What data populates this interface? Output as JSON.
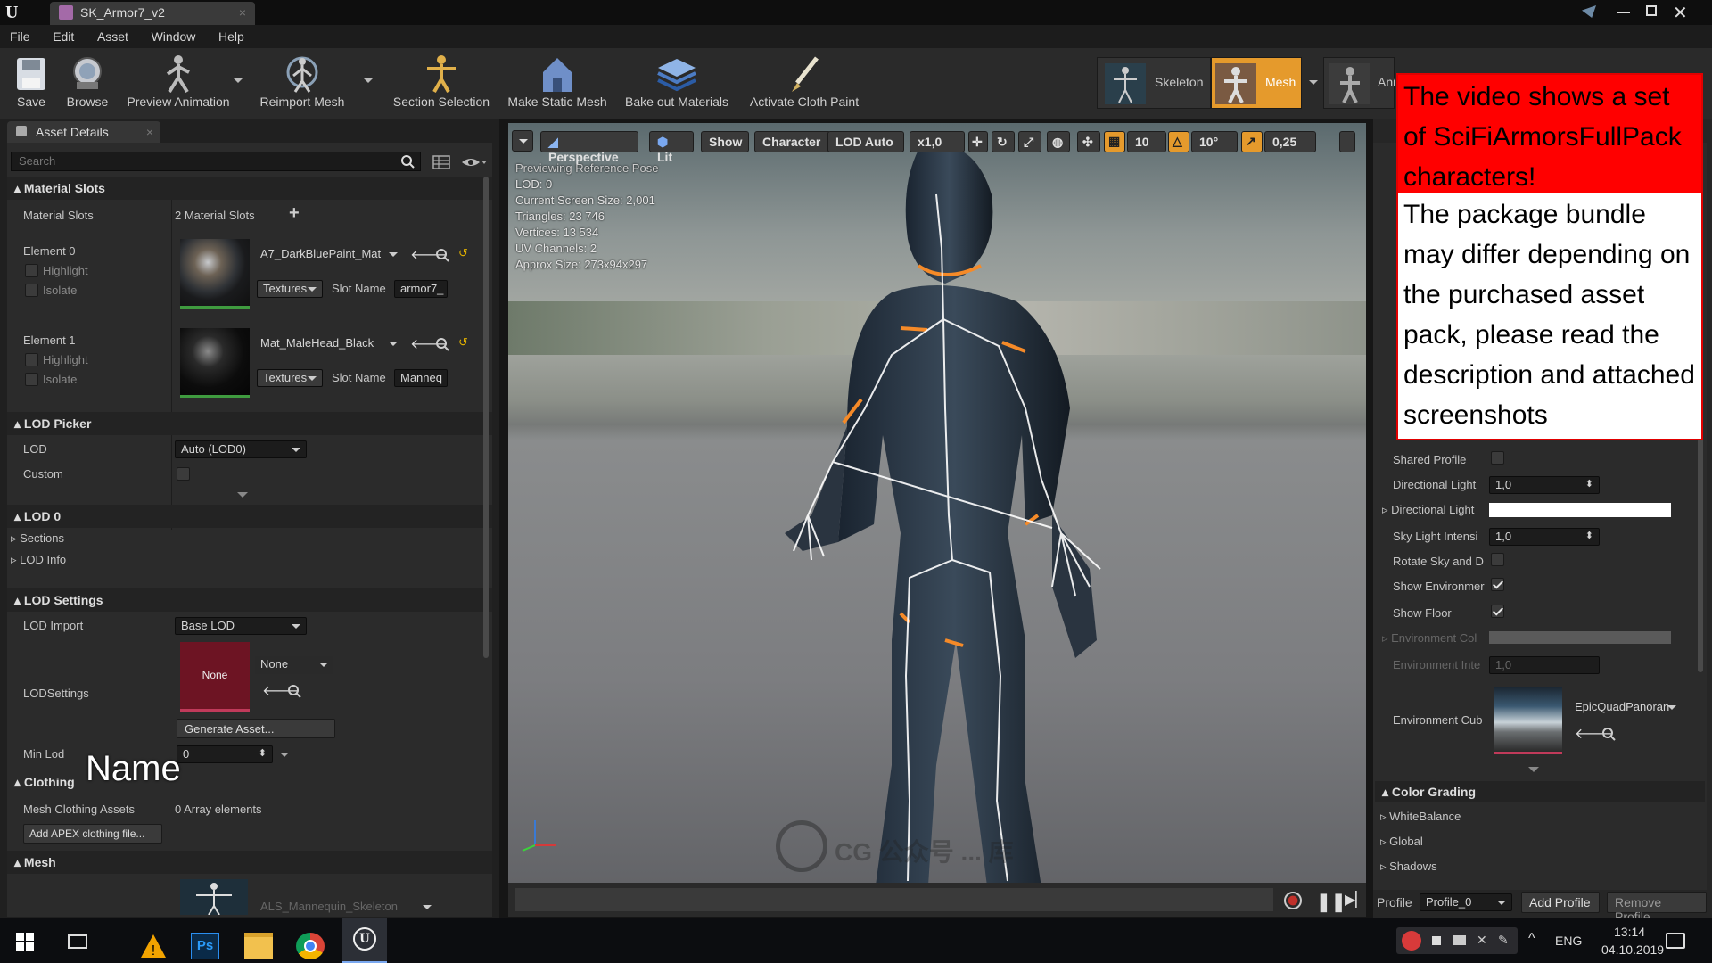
{
  "window": {
    "tab_title": "SK_Armor7_v2"
  },
  "menu": [
    "File",
    "Edit",
    "Asset",
    "Window",
    "Help"
  ],
  "toolbar": {
    "save": "Save",
    "browse": "Browse",
    "preview_animation": "Preview Animation",
    "reimport_mesh": "Reimport Mesh",
    "section_selection": "Section Selection",
    "make_static_mesh": "Make Static Mesh",
    "bake_out_materials": "Bake out Materials",
    "activate_cloth_paint": "Activate Cloth Paint"
  },
  "modes": {
    "skeleton": "Skeleton",
    "mesh": "Mesh",
    "animation": "Ani"
  },
  "details": {
    "tab": "Asset Details",
    "search_placeholder": "Search",
    "material_slots": {
      "header": "Material Slots",
      "label": "Material Slots",
      "count": "2 Material Slots",
      "elements": [
        {
          "name": "Element 0",
          "highlight": "Highlight",
          "isolate": "Isolate",
          "material": "A7_DarkBluePaint_Mat",
          "textures": "Textures",
          "slot_label": "Slot Name",
          "slot_name": "armor7_"
        },
        {
          "name": "Element 1",
          "highlight": "Highlight",
          "isolate": "Isolate",
          "material": "Mat_MaleHead_Black",
          "textures": "Textures",
          "slot_label": "Slot Name",
          "slot_name": "Manneq"
        }
      ]
    },
    "lod_picker": {
      "header": "LOD Picker",
      "lod_label": "LOD",
      "lod_value": "Auto (LOD0)",
      "custom_label": "Custom"
    },
    "lod0": {
      "header": "LOD 0",
      "sections": "Sections",
      "lod_info": "LOD Info"
    },
    "lod_settings": {
      "header": "LOD Settings",
      "lod_import_label": "LOD Import",
      "lod_import_value": "Base LOD",
      "lodsettings_label": "LODSettings",
      "thumb_text": "None",
      "asset_value": "None",
      "generate": "Generate Asset...",
      "min_lod_label": "Min Lod",
      "min_lod_value": "0"
    },
    "clothing": {
      "header": "Clothing",
      "assets_label": "Mesh Clothing Assets",
      "assets_value": "0 Array elements",
      "add_button": "Add APEX clothing file..."
    },
    "mesh": {
      "header": "Mesh",
      "skeleton_value": "ALS_Mannequin_Skeleton"
    },
    "overlay_name": "Name"
  },
  "viewport": {
    "perspective": "Perspective",
    "lit": "Lit",
    "show": "Show",
    "character": "Character",
    "lod_auto": "LOD Auto",
    "speed": "x1,0",
    "grid": "10",
    "angle": "10°",
    "scale": "0,25",
    "stats": [
      "Previewing Reference Pose",
      "LOD: 0",
      "Current Screen Size: 2,001",
      "Triangles: 23 746",
      "Vertices: 13 534",
      "UV Channels: 2",
      "Approx Size: 273x94x297"
    ],
    "watermark": "CG 公众号 ... 库"
  },
  "scene_settings": {
    "rows": [
      {
        "label": "Shared Profile"
      },
      {
        "label": "Directional Light",
        "value": "1,0"
      },
      {
        "label": "Directional Light"
      },
      {
        "label": "Sky Light Intensi",
        "value": "1,0"
      },
      {
        "label": "Rotate Sky and D"
      },
      {
        "label": "Show Environmer"
      },
      {
        "label": "Show Floor"
      },
      {
        "label": "Environment Col"
      },
      {
        "label": "Environment Inte",
        "value": "1,0"
      },
      {
        "label": "Environment Cub",
        "asset": "EpicQuadPanoran"
      }
    ],
    "color_grading": {
      "header": "Color Grading",
      "items": [
        "WhiteBalance",
        "Global",
        "Shadows"
      ]
    },
    "profile_label": "Profile",
    "profile_value": "Profile_0",
    "add_profile": "Add Profile",
    "remove_profile": "Remove Profile"
  },
  "banner": {
    "red_text": "The video shows a set of SciFiArmorsFullPack characters!",
    "white_text": "The package bundle may differ depending on the purchased asset pack, please read the description and attached screenshots"
  },
  "taskbar": {
    "lang": "ENG",
    "time": "13:14",
    "date": "04.10.2019",
    "ps": "Ps"
  }
}
